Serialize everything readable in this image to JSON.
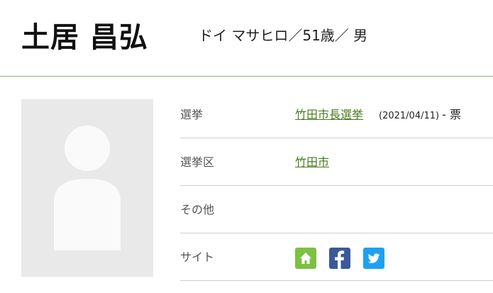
{
  "profile": {
    "name": "土居 昌弘",
    "kana_age_gender": "ドイ マサヒロ／51歳／ 男"
  },
  "rows": {
    "election": {
      "label": "選挙",
      "link": "竹田市長選挙",
      "date": "(2021/04/11)",
      "vote": "- 票"
    },
    "district": {
      "label": "選挙区",
      "link": "竹田市"
    },
    "other": {
      "label": "その他"
    },
    "site": {
      "label": "サイト",
      "icons": [
        "home-icon",
        "facebook-icon",
        "twitter-icon"
      ]
    }
  },
  "colors": {
    "accent_line": "#8bb85a",
    "link": "#4a7a1e",
    "home": "#7cc142",
    "facebook": "#3b5998",
    "twitter": "#1da1f2"
  }
}
